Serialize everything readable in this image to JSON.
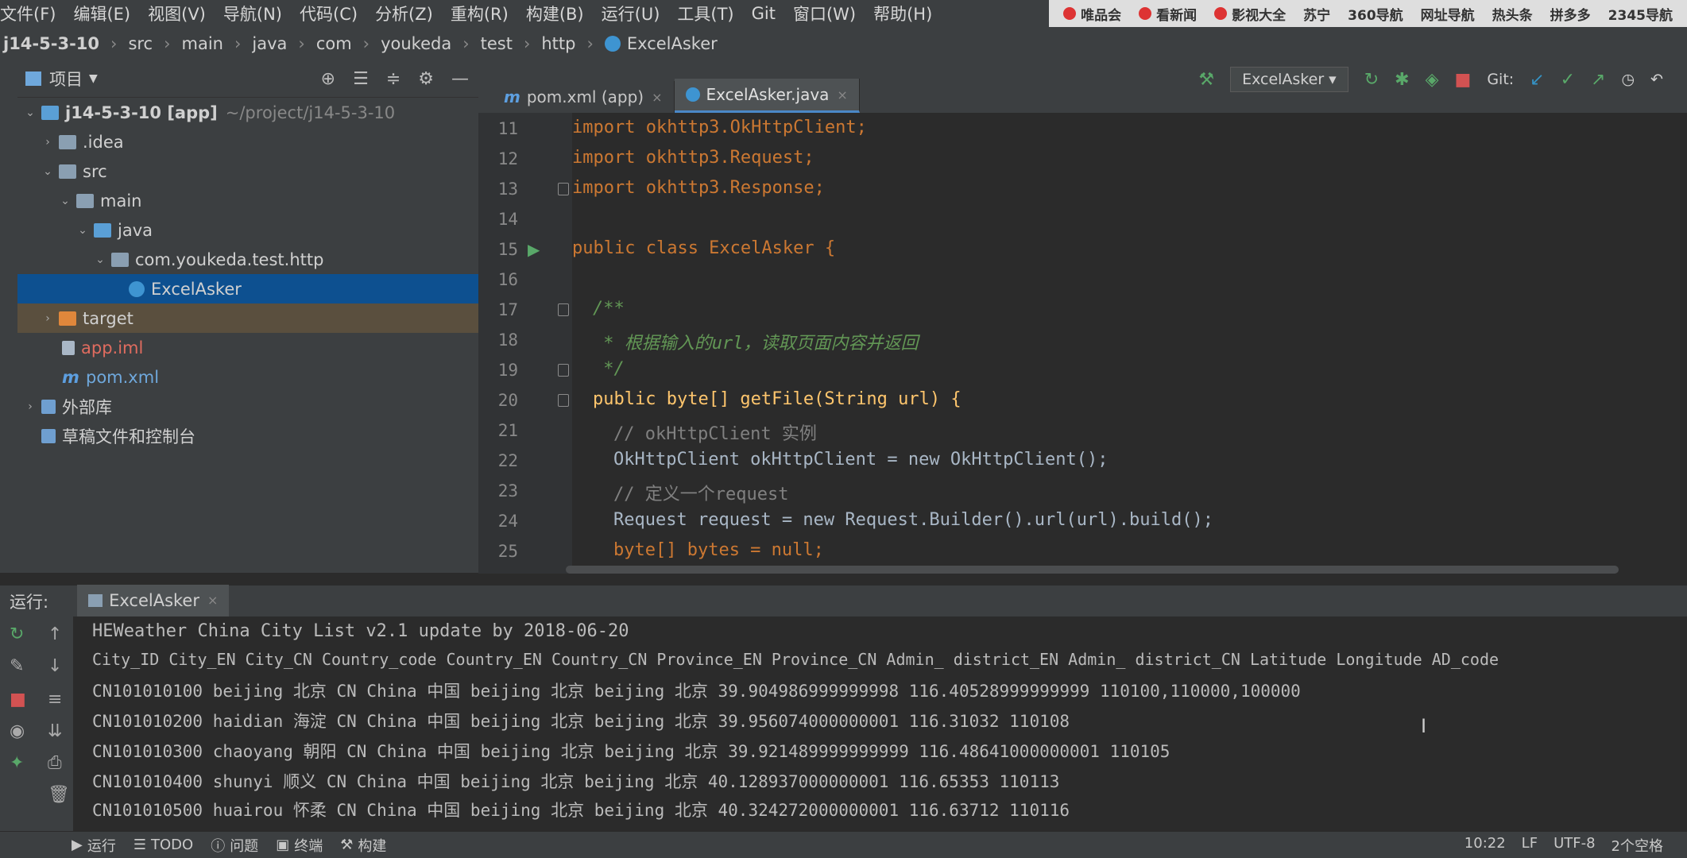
{
  "menubar": {
    "items": [
      "文件(F)",
      "编辑(E)",
      "视图(V)",
      "导航(N)",
      "代码(C)",
      "分析(Z)",
      "重构(R)",
      "构建(B)",
      "运行(U)",
      "工具(T)",
      "Git",
      "窗口(W)",
      "帮助(H)"
    ],
    "bookmarks": [
      "唯品会",
      "看新闻",
      "影视大全",
      "苏宁",
      "360导航",
      "网址导航",
      "热头条",
      "拼多多",
      "2345导航"
    ]
  },
  "breadcrumb": [
    "j14-5-3-10",
    "src",
    "main",
    "java",
    "com",
    "youkeda",
    "test",
    "http",
    "ExcelAsker"
  ],
  "project": {
    "title": "项目",
    "tree": [
      {
        "label": "j14-5-3-10 [app]",
        "extra": "~/project/j14-5-3-10",
        "depth": 0,
        "expanded": true
      },
      {
        "label": ".idea",
        "depth": 1,
        "expanded": false
      },
      {
        "label": "src",
        "depth": 1,
        "expanded": true
      },
      {
        "label": "main",
        "depth": 2,
        "expanded": true
      },
      {
        "label": "java",
        "depth": 3,
        "expanded": true
      },
      {
        "label": "com.youkeda.test.http",
        "depth": 4,
        "expanded": true
      },
      {
        "label": "ExcelAsker",
        "depth": 5
      },
      {
        "label": "target",
        "depth": 1,
        "expanded": false
      },
      {
        "label": "app.iml",
        "depth": 1
      },
      {
        "label": "pom.xml",
        "depth": 1
      },
      {
        "label": "外部库",
        "depth": 0,
        "expanded": false
      },
      {
        "label": "草稿文件和控制台",
        "depth": 0
      }
    ]
  },
  "editor": {
    "tabs": [
      {
        "label": "pom.xml (app)",
        "active": false
      },
      {
        "label": "ExcelAsker.java",
        "active": true
      }
    ],
    "run_config": "ExcelAsker",
    "git_label": "Git:",
    "lines": [
      {
        "n": "11",
        "code": "import okhttp3.OkHttpClient;"
      },
      {
        "n": "12",
        "code": "import okhttp3.Request;"
      },
      {
        "n": "13",
        "code": "import okhttp3.Response;"
      },
      {
        "n": "14",
        "code": ""
      },
      {
        "n": "15",
        "code": "public class ExcelAsker {"
      },
      {
        "n": "16",
        "code": ""
      },
      {
        "n": "17",
        "code": "/**"
      },
      {
        "n": "18",
        "code": " * 根据输入的url，读取页面内容并返回"
      },
      {
        "n": "19",
        "code": " */"
      },
      {
        "n": "20",
        "code": "public byte[] getFile(String url) {"
      },
      {
        "n": "21",
        "code": "// okHttpClient 实例"
      },
      {
        "n": "22",
        "code": "OkHttpClient okHttpClient = new OkHttpClient();"
      },
      {
        "n": "23",
        "code": "// 定义一个request"
      },
      {
        "n": "24",
        "code": "Request request = new Request.Builder().url(url).build();"
      },
      {
        "n": "25",
        "code": "byte[] bytes = null;"
      }
    ]
  },
  "run": {
    "label": "运行:",
    "tab": "ExcelAsker",
    "output": [
      "HEWeather China City List v2.1 update by 2018-06-20",
      "City_ID City_EN City_CN Country_code Country_EN Country_CN Province_EN Province_CN Admin_ district_EN Admin_ district_CN Latitude Longitude AD_code",
      "CN101010100 beijing 北京 CN China 中国 beijing 北京 beijing 北京 39.904986999999998 116.40528999999999 110100,110000,100000",
      "CN101010200 haidian 海淀 CN China 中国 beijing 北京 beijing 北京 39.956074000000001 116.31032 110108",
      "CN101010300 chaoyang 朝阳 CN China 中国 beijing 北京 beijing 北京 39.921489999999999 116.48641000000001 110105",
      "CN101010400 shunyi 顺义 CN China 中国 beijing 北京 beijing 北京 40.128937000000001 116.65353 110113",
      "CN101010500 huairou 怀柔 CN China 中国 beijing 北京 beijing 北京 40.324272000000001 116.63712 110116"
    ]
  },
  "statusbar": {
    "tabs": [
      "运行",
      "TODO",
      "问题",
      "终端",
      "构建"
    ],
    "position": "10:22",
    "line_sep": "LF",
    "encoding": "UTF-8",
    "indent": "2个空格"
  }
}
